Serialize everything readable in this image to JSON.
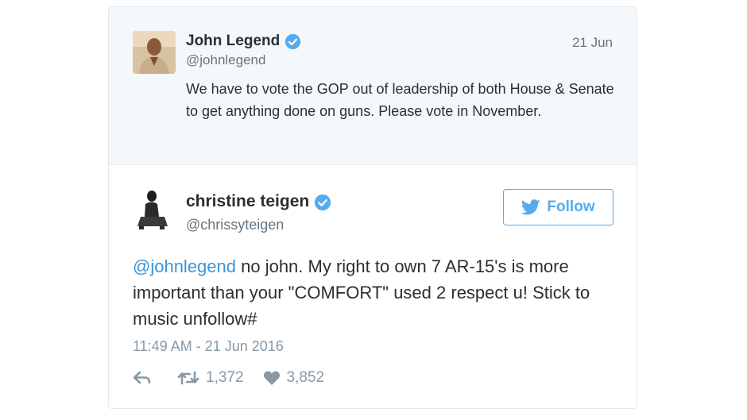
{
  "parent_tweet": {
    "name": "John Legend",
    "handle": "@johnlegend",
    "date": "21 Jun",
    "text": "We have to vote the GOP out of leadership of both House & Senate to get anything done on guns. Please vote in November.",
    "avatar_icon": "person-photo-icon"
  },
  "reply_tweet": {
    "name": "christine teigen",
    "handle": "@chrissyteigen",
    "follow_label": "Follow",
    "mention": "@johnlegend",
    "text": " no john. My right to own 7 AR-15's is more important than your \"COMFORT\" used 2 respect u! Stick to music unfollow#",
    "timestamp": "11:49 AM - 21 Jun 2016",
    "retweets": "1,372",
    "likes": "3,852",
    "avatar_icon": "person-photo-icon"
  },
  "colors": {
    "accent": "#55acee",
    "mention": "#3b94d9",
    "muted": "#66757f",
    "parent_bg": "#f5f8fa"
  }
}
